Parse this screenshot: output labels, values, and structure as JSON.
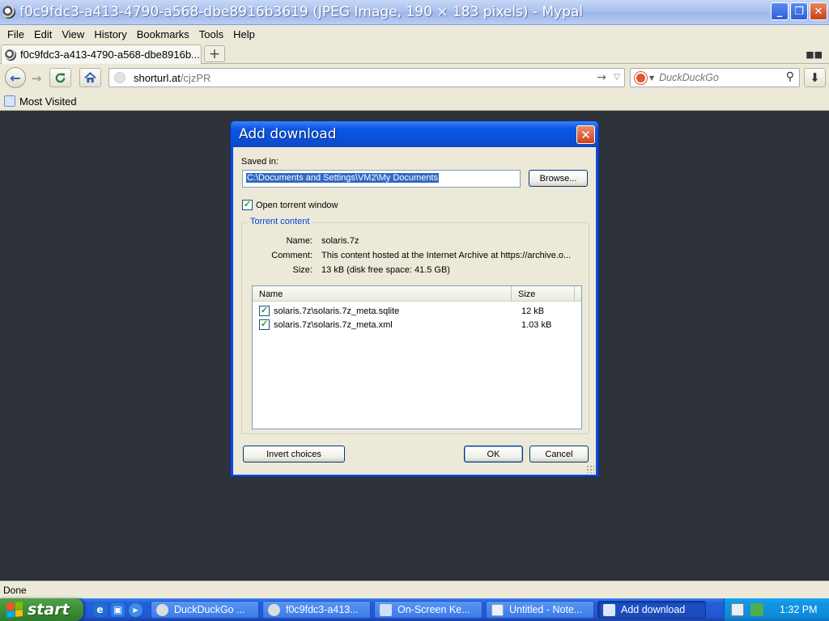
{
  "window": {
    "title": "f0c9fdc3-a413-4790-a568-dbe8916b3619 (JPEG Image, 190 × 183 pixels) - Mypal",
    "controls": {
      "minimize": "_",
      "maximize": "❐",
      "close": "✕"
    }
  },
  "menu": [
    "File",
    "Edit",
    "View",
    "History",
    "Bookmarks",
    "Tools",
    "Help"
  ],
  "tab": {
    "label": "f0c9fdc3-a413-4790-a568-dbe8916b...",
    "new_tab": "+"
  },
  "nav": {
    "url_host": "shorturl.at",
    "url_path": "/cjzPR",
    "search_placeholder": "DuckDuckGo"
  },
  "bookmarks": {
    "most_visited": "Most Visited"
  },
  "dialog": {
    "title": "Add download",
    "saved_in_label": "Saved in:",
    "saved_in_path": "C:\\Documents and Settings\\VM2\\My Documents",
    "browse_label": "Browse...",
    "open_torrent_label": "Open torrent window",
    "open_torrent_checked": true,
    "torrent_group_label": "Torrent content",
    "info": {
      "name_label": "Name:",
      "name_value": "solaris.7z",
      "comment_label": "Comment:",
      "comment_value": "This content hosted at the Internet Archive at https://archive.o...",
      "size_label": "Size:",
      "size_value": "13 kB (disk free space: 41.5 GB)"
    },
    "file_list": {
      "columns": [
        "Name",
        "Size"
      ],
      "rows": [
        {
          "name": "solaris.7z\\solaris.7z_meta.sqlite",
          "size": "12 kB",
          "checked": true
        },
        {
          "name": "solaris.7z\\solaris.7z_meta.xml",
          "size": "1.03 kB",
          "checked": true
        }
      ]
    },
    "invert_label": "Invert choices",
    "ok_label": "OK",
    "cancel_label": "Cancel"
  },
  "status": {
    "text": "Done"
  },
  "taskbar": {
    "start_label": "start",
    "tasks": [
      {
        "label": "DuckDuckGo ...",
        "active": false
      },
      {
        "label": "f0c9fdc3-a413...",
        "active": false
      },
      {
        "label": "On-Screen Ke...",
        "active": false
      },
      {
        "label": "Untitled - Note...",
        "active": false
      },
      {
        "label": "Add download",
        "active": true
      }
    ],
    "clock": "1:32 PM"
  },
  "colors": {
    "dialog_frame": "#0c4ad9",
    "selection": "#316ac5",
    "taskbar": "#245edb",
    "start_button": "#3c9038",
    "page_background": "#2d3338"
  }
}
